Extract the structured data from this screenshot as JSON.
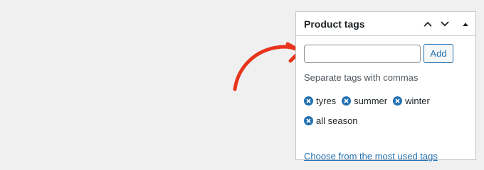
{
  "metabox": {
    "title": "Product tags",
    "controls": {
      "move_up_icon": "chevron-up-icon",
      "move_down_icon": "chevron-down-icon",
      "toggle_icon": "triangle-up-icon"
    },
    "input": {
      "value": "",
      "placeholder": ""
    },
    "add_label": "Add",
    "hint": "Separate tags with commas",
    "tags": [
      {
        "label": "tyres"
      },
      {
        "label": "summer"
      },
      {
        "label": "winter"
      },
      {
        "label": "all season"
      }
    ],
    "most_used_link": "Choose from the most used tags"
  },
  "annotation": {
    "arrow_icon": "curved-arrow-icon",
    "color": "#e8341c"
  },
  "colors": {
    "background": "#f0f0f1",
    "accent": "#2271b1",
    "border": "#c3c4c7"
  }
}
